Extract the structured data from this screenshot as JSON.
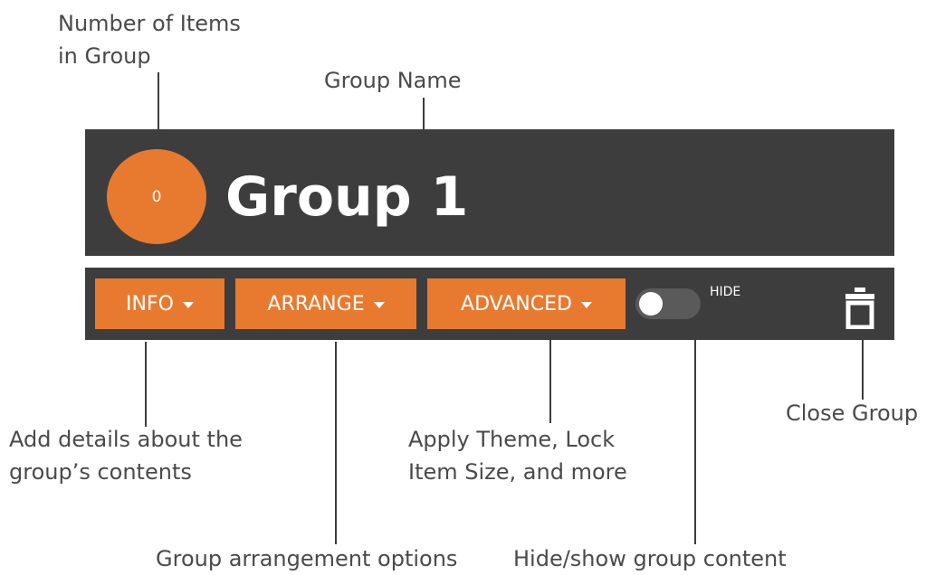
{
  "group": {
    "item_count": "0",
    "name": "Group 1"
  },
  "toolbar": {
    "info_label": "INFO",
    "arrange_label": "ARRANGE",
    "advanced_label": "ADVANCED",
    "hide_label": "HIDE"
  },
  "annotations": {
    "item_count": [
      "Number of Items",
      "in Group"
    ],
    "group_name": "Group Name",
    "info": [
      "Add details about the",
      "group’s contents"
    ],
    "arrange": "Group arrangement options",
    "advanced": [
      "Apply Theme, Lock",
      "Item Size, and more"
    ],
    "hide": "Hide/show group content",
    "close": "Close Group"
  },
  "colors": {
    "panel": "#3d3d3d",
    "accent": "#e87a2f",
    "annotation_text": "#4a4a4a"
  },
  "icons": {
    "dropdown": "caret-down-icon",
    "close": "trash-icon"
  }
}
